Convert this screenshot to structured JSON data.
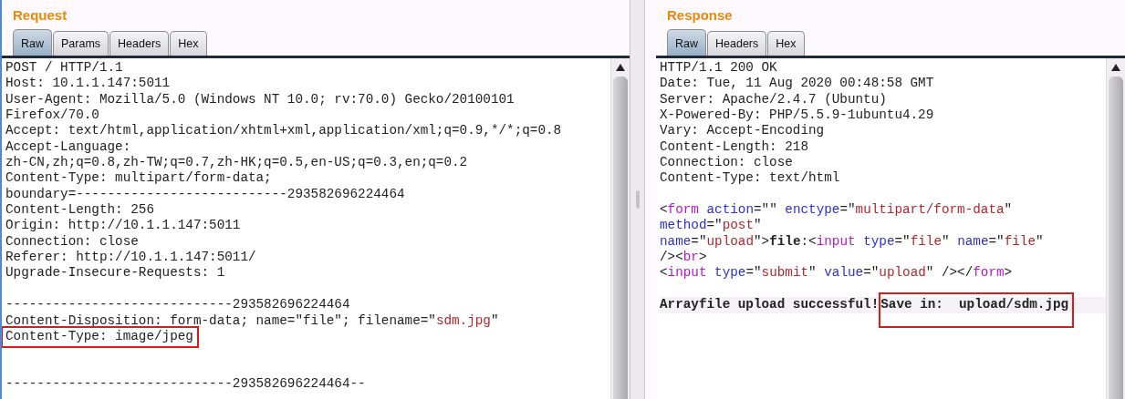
{
  "panels": [
    {
      "title": "Request",
      "tabs": [
        {
          "label": "Raw",
          "selected": true
        },
        {
          "label": "Params",
          "selected": false
        },
        {
          "label": "Headers",
          "selected": false
        },
        {
          "label": "Hex",
          "selected": false
        }
      ],
      "lines": [
        {
          "segments": [
            {
              "text": "POST / HTTP/1.1",
              "kind": "plain"
            }
          ]
        },
        {
          "segments": [
            {
              "text": "Host: 10.1.1.147:5011",
              "kind": "plain"
            }
          ]
        },
        {
          "segments": [
            {
              "text": "User-Agent: Mozilla/5.0 (Windows NT 10.0; rv:70.0) Gecko/20100101",
              "kind": "plain"
            }
          ]
        },
        {
          "segments": [
            {
              "text": "Firefox/70.0",
              "kind": "plain"
            }
          ]
        },
        {
          "segments": [
            {
              "text": "Accept: text/html,application/xhtml+xml,application/xml;q=0.9,*/*;q=0.8",
              "kind": "plain"
            }
          ]
        },
        {
          "segments": [
            {
              "text": "Accept-Language:",
              "kind": "plain"
            }
          ]
        },
        {
          "segments": [
            {
              "text": "zh-CN,zh;q=0.8,zh-TW;q=0.7,zh-HK;q=0.5,en-US;q=0.3,en;q=0.2",
              "kind": "plain"
            }
          ]
        },
        {
          "segments": [
            {
              "text": "Content-Type: multipart/form-data;",
              "kind": "plain"
            }
          ]
        },
        {
          "segments": [
            {
              "text": "boundary=---------------------------293582696224464",
              "kind": "plain"
            }
          ]
        },
        {
          "segments": [
            {
              "text": "Content-Length: 256",
              "kind": "plain"
            }
          ]
        },
        {
          "segments": [
            {
              "text": "Origin: http://10.1.1.147:5011",
              "kind": "plain"
            }
          ]
        },
        {
          "segments": [
            {
              "text": "Connection: close",
              "kind": "plain"
            }
          ]
        },
        {
          "segments": [
            {
              "text": "Referer: http://10.1.1.147:5011/",
              "kind": "plain"
            }
          ]
        },
        {
          "segments": [
            {
              "text": "Upgrade-Insecure-Requests: 1",
              "kind": "plain"
            }
          ]
        },
        {
          "kind": "blank"
        },
        {
          "segments": [
            {
              "text": "-----------------------------293582696224464",
              "kind": "plain"
            }
          ]
        },
        {
          "segments": [
            {
              "text": "Content-Disposition: form-data; name=\"file\"; filename=\"",
              "kind": "plain"
            },
            {
              "text": "sdm.jpg",
              "kind": "value"
            },
            {
              "text": "\"",
              "kind": "plain"
            }
          ]
        },
        {
          "segments": [
            {
              "text": "Content-Type: image/jpeg",
              "kind": "plain",
              "highlighted": true
            }
          ]
        },
        {
          "kind": "blank"
        },
        {
          "kind": "blank"
        },
        {
          "segments": [
            {
              "text": "-----------------------------293582696224464--",
              "kind": "plain"
            }
          ]
        }
      ]
    },
    {
      "title": "Response",
      "tabs": [
        {
          "label": "Raw",
          "selected": true
        },
        {
          "label": "Headers",
          "selected": false
        },
        {
          "label": "Hex",
          "selected": false
        }
      ],
      "lines": [
        {
          "segments": [
            {
              "text": "HTTP/1.1 200 OK",
              "kind": "plain"
            }
          ]
        },
        {
          "segments": [
            {
              "text": "Date: Tue, 11 Aug 2020 00:48:58 GMT",
              "kind": "plain"
            }
          ]
        },
        {
          "segments": [
            {
              "text": "Server: Apache/2.4.7 (Ubuntu)",
              "kind": "plain"
            }
          ]
        },
        {
          "segments": [
            {
              "text": "X-Powered-By: PHP/5.5.9-1ubuntu4.29",
              "kind": "plain"
            }
          ]
        },
        {
          "segments": [
            {
              "text": "Vary: Accept-Encoding",
              "kind": "plain"
            }
          ]
        },
        {
          "segments": [
            {
              "text": "Content-Length: 218",
              "kind": "plain"
            }
          ]
        },
        {
          "segments": [
            {
              "text": "Connection: close",
              "kind": "plain"
            }
          ]
        },
        {
          "segments": [
            {
              "text": "Content-Type: text/html",
              "kind": "plain"
            }
          ]
        },
        {
          "kind": "blank"
        },
        {
          "segments": [
            {
              "text": "<",
              "kind": "plain"
            },
            {
              "text": "form",
              "kind": "tag"
            },
            {
              "text": " action",
              "kind": "attr"
            },
            {
              "text": "=\"\" ",
              "kind": "plain"
            },
            {
              "text": "enctype",
              "kind": "attr"
            },
            {
              "text": "=\"",
              "kind": "plain"
            },
            {
              "text": "multipart/form-data",
              "kind": "value"
            },
            {
              "text": "\"",
              "kind": "plain"
            }
          ]
        },
        {
          "segments": [
            {
              "text": "method",
              "kind": "attr"
            },
            {
              "text": "=\"",
              "kind": "plain"
            },
            {
              "text": "post",
              "kind": "value"
            },
            {
              "text": "\"",
              "kind": "plain"
            }
          ]
        },
        {
          "segments": [
            {
              "text": "name",
              "kind": "attr"
            },
            {
              "text": "=\"",
              "kind": "plain"
            },
            {
              "text": "upload",
              "kind": "value"
            },
            {
              "text": "\">",
              "kind": "plain"
            },
            {
              "text": "file",
              "kind": "bold"
            },
            {
              "text": ":<",
              "kind": "plain"
            },
            {
              "text": "input",
              "kind": "tag"
            },
            {
              "text": " type",
              "kind": "attr"
            },
            {
              "text": "=\"",
              "kind": "plain"
            },
            {
              "text": "file",
              "kind": "value"
            },
            {
              "text": "\" ",
              "kind": "plain"
            },
            {
              "text": "name",
              "kind": "attr"
            },
            {
              "text": "=\"",
              "kind": "plain"
            },
            {
              "text": "file",
              "kind": "value"
            },
            {
              "text": "\"",
              "kind": "plain"
            }
          ]
        },
        {
          "segments": [
            {
              "text": "/><",
              "kind": "plain"
            },
            {
              "text": "br",
              "kind": "tag"
            },
            {
              "text": ">",
              "kind": "plain"
            }
          ]
        },
        {
          "segments": [
            {
              "text": "<",
              "kind": "plain"
            },
            {
              "text": "input",
              "kind": "tag"
            },
            {
              "text": " type",
              "kind": "attr"
            },
            {
              "text": "=\"",
              "kind": "plain"
            },
            {
              "text": "submit",
              "kind": "value"
            },
            {
              "text": "\" ",
              "kind": "plain"
            },
            {
              "text": "value",
              "kind": "attr"
            },
            {
              "text": "=\"",
              "kind": "plain"
            },
            {
              "text": "upload",
              "kind": "value"
            },
            {
              "text": "\" /></",
              "kind": "plain"
            },
            {
              "text": "form",
              "kind": "tag"
            },
            {
              "text": ">",
              "kind": "plain"
            }
          ]
        },
        {
          "kind": "blank"
        },
        {
          "current": true,
          "segments": [
            {
              "text": "Arrayfile upload successful!",
              "kind": "bold"
            },
            {
              "text": "Save in:  upload/sdm.jpg",
              "kind": "bold",
              "highlighted": true
            }
          ]
        }
      ]
    }
  ]
}
